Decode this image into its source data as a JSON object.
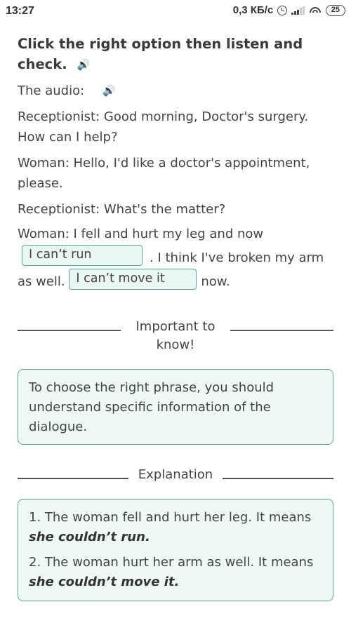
{
  "status_bar": {
    "time": "13:27",
    "net_speed": "0,3 КБ/с",
    "battery": "25",
    "icons": [
      "alarm-icon",
      "signal-icon",
      "wifi-icon",
      "battery-icon"
    ]
  },
  "task": {
    "title": "Click the right option then listen and check.",
    "title_icon": "speaker-icon",
    "audio_label": "The audio:",
    "audio_icon": "speaker-icon"
  },
  "dialogue": {
    "line1": "Receptionist: Good morning, Doctor's surgery. How can I help?",
    "line2": "Woman: Hello, I'd like a doctor's appointment, please.",
    "line3": "Receptionist: What's the matter?",
    "line4_part1": "Woman: I fell and hurt my leg and now",
    "gap1": "I can’t run",
    "line4_part2": ". I think I've broken my arm as well.",
    "gap2": "I can’t move it",
    "line4_part3": "now."
  },
  "important": {
    "heading": "Important to know!",
    "text": "To choose the right phrase, you should understand specific information of the dialogue."
  },
  "explanation": {
    "heading": "Explanation",
    "items": [
      {
        "text": "1. The woman fell and hurt her leg. It means ",
        "emphasis": "she couldn’t run."
      },
      {
        "text": "2. The woman hurt her arm as well. It means ",
        "emphasis": "she couldn’t move it."
      }
    ]
  },
  "colors": {
    "accent_border": "#5aa79a",
    "box_background": "#eef8f5",
    "text": "#444444"
  }
}
